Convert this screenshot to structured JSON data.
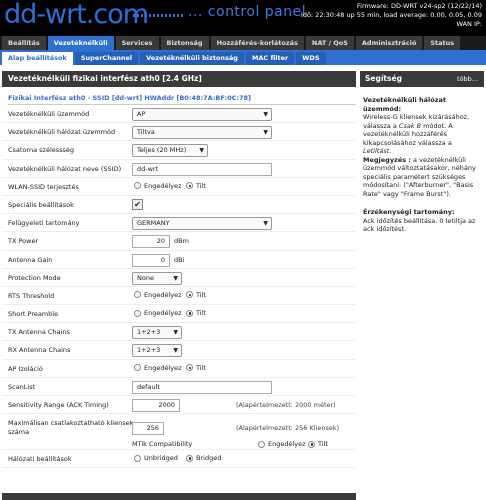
{
  "header": {
    "logo": "dd-wrt.com",
    "control_panel": "... control panel",
    "firmware": "Firmware: DD-WRT v24-sp2 (12/22/14)",
    "time": "Idő: 22:30:48 up 55 min, load average: 0.00, 0.05, 0.09",
    "wan_ip": "WAN IP:"
  },
  "main_tabs": [
    {
      "label": "Beállítás",
      "active": false
    },
    {
      "label": "Vezetéknélküli",
      "active": true
    },
    {
      "label": "Services",
      "active": false
    },
    {
      "label": "Biztonság",
      "active": false
    },
    {
      "label": "Hozzáférés-korlátozás",
      "active": false
    },
    {
      "label": "NAT / QoS",
      "active": false
    },
    {
      "label": "Adminisztráció",
      "active": false
    },
    {
      "label": "Status",
      "active": false
    }
  ],
  "sub_tabs": [
    {
      "label": "Alap beállítások",
      "active": true
    },
    {
      "label": "SuperChannel",
      "active": false
    },
    {
      "label": "Vezetéknélküli biztonság",
      "active": false
    },
    {
      "label": "MAC filter",
      "active": false
    },
    {
      "label": "WDS",
      "active": false
    }
  ],
  "panel": {
    "title": "Vezetéknélküli fizikai interfész ath0 [2.4 GHz]",
    "section": "Fizikai Interfész ath0 - SSID [dd-wrt] HWAddr [B0:48:7A:BF:0C:78]",
    "fields": {
      "mode": {
        "label": "Vezetéknélküli üzemmód",
        "value": "AP"
      },
      "network_mode": {
        "label": "Vezetéknélküli hálózat üzemmód",
        "value": "Tiltva"
      },
      "channel_width": {
        "label": "Csatorna szélessség",
        "value": "Teljes (20 MHz)"
      },
      "ssid": {
        "label": "Vezetéknélküli hálózat neve (SSID)",
        "value": "dd-wrt"
      },
      "ssid_broadcast": {
        "label": "WLAN-SSID terjesztés",
        "opt1": "Engedélyez",
        "opt2": "Tilt",
        "selected": 2
      },
      "advanced": {
        "label": "Speciális beállítások",
        "checked": "✔"
      },
      "regulatory": {
        "label": "Felügyeleti tartomány",
        "value": "GERMANY"
      },
      "tx_power": {
        "label": "TX Power",
        "value": "20",
        "unit": "dBm"
      },
      "antenna_gain": {
        "label": "Antenna Gain",
        "value": "0",
        "unit": "dBi"
      },
      "protection": {
        "label": "Protection Mode",
        "value": "None"
      },
      "rts": {
        "label": "RTS Threshold",
        "opt1": "Engedélyez",
        "opt2": "Tilt",
        "selected": 2
      },
      "short_preamble": {
        "label": "Short Preamble",
        "opt1": "Engedélyez",
        "opt2": "Tilt",
        "selected": 2
      },
      "tx_chains": {
        "label": "TX Antenna Chains",
        "value": "1+2+3"
      },
      "rx_chains": {
        "label": "RX Antenna Chains",
        "value": "1+2+3"
      },
      "ap_isolation": {
        "label": "AP Izoláció",
        "opt1": "Engedélyez",
        "opt2": "Tilt",
        "selected": 2
      },
      "scanlist": {
        "label": "ScanList",
        "value": "default"
      },
      "sensitivity": {
        "label": "Sensitivity Range (ACK Timing)",
        "value": "2000",
        "hint": "(Alapértelmezett: 2000 méter)"
      },
      "max_clients": {
        "label1": "Maximálisan csatlakoztatható kliensek",
        "label2": "száma",
        "value": "256",
        "hint": "(Alapértelmezett: 256 Kliensek)"
      },
      "mtik": {
        "label": "MTik Compatibility",
        "opt1": "Engedélyez",
        "opt2": "Tilt",
        "selected": 2
      },
      "bridging": {
        "label": "Hálózati beállítások",
        "opt1": "Unbridged",
        "opt2": "Bridged",
        "selected": 2
      }
    }
  },
  "help": {
    "title": "Segítség",
    "more": "több...",
    "h1": "Vezetéknélküli hálózat üzemmód:",
    "p1_a": "Wireless-G kliensek kizárásához, válassza a ",
    "p1_b": "Csak B",
    "p1_c": " módot. A vezetéknélküli hozzáférés kikapcsolásához válassza a ",
    "p1_d": "Letiltást",
    "p1_e": ".",
    "p2_b": "Megjegyzés :",
    "p2_rest": " a vezetéknélküli üzemmód változtatásakor, néhány speciális paramétert szükséges módosítani: (\"Afterburner\", \"Basis Rate\" vagy \"Frame Burst\").",
    "h2": "Érzékenységi tartomány:",
    "p3": "Ack időzítés beállítása. 0 letiltja az ack időzítést."
  }
}
